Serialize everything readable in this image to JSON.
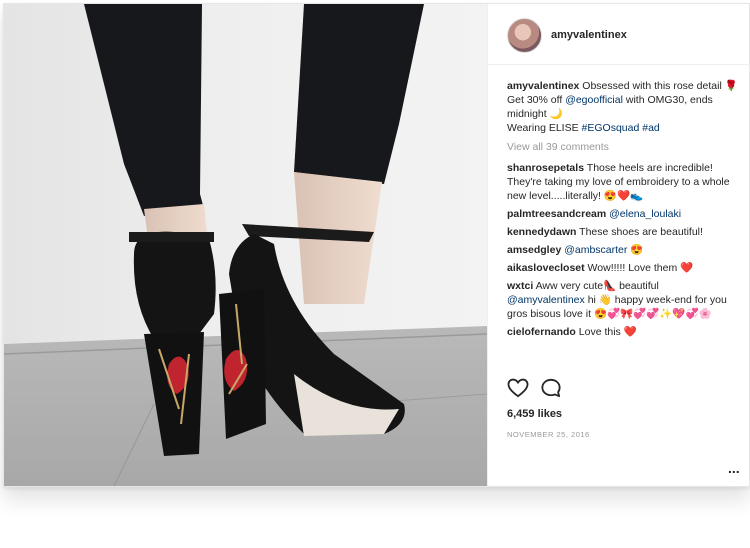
{
  "post": {
    "username": "amyvalentinex",
    "caption_user": "amyvalentinex",
    "caption_text_1": " Obsessed with this rose detail 🌹 Get 30% off ",
    "caption_tag_1": "@egoofficial",
    "caption_text_2": " with OMG30, ends midnight 🌙",
    "caption_text_3": "Wearing ELISE ",
    "caption_tag_2": "#EGOsquad",
    "caption_tag_3": "#ad",
    "view_all": "View all 39 comments",
    "likes": "6,459 likes",
    "date": "NOVEMBER 25, 2016",
    "more": "..."
  },
  "comments": [
    {
      "user": "shanrosepetals",
      "text": " Those heels are incredible! They're taking my love of embroidery to a whole new level.....literally! 😍❤️👟",
      "tag": ""
    },
    {
      "user": "palmtreesandcream",
      "text": " ",
      "tag": "@elena_loulaki"
    },
    {
      "user": "kennedydawn",
      "text": " These shoes are beautiful!",
      "tag": ""
    },
    {
      "user": "amsedgley",
      "text": " ",
      "tag": "@ambscarter",
      "after": " 😍"
    },
    {
      "user": "aikaslovecloset",
      "text": " Wow!!!!! Love them ❤️",
      "tag": ""
    },
    {
      "user": "wxtci",
      "text": " Aww very cute👠 beautiful ",
      "tag": "@amyvalentinex",
      "after": " hi 👋 happy week-end for you gros bisous love it 😍💞🎀💞💞✨💖💞🌸"
    },
    {
      "user": "cielofernando",
      "text": " Love this ❤️",
      "tag": ""
    }
  ],
  "icons": {
    "like": "heart-icon",
    "comment": "comment-bubble-icon",
    "more": "more-options-icon"
  },
  "colors": {
    "link": "#003569",
    "muted": "#999999",
    "text": "#262626"
  }
}
